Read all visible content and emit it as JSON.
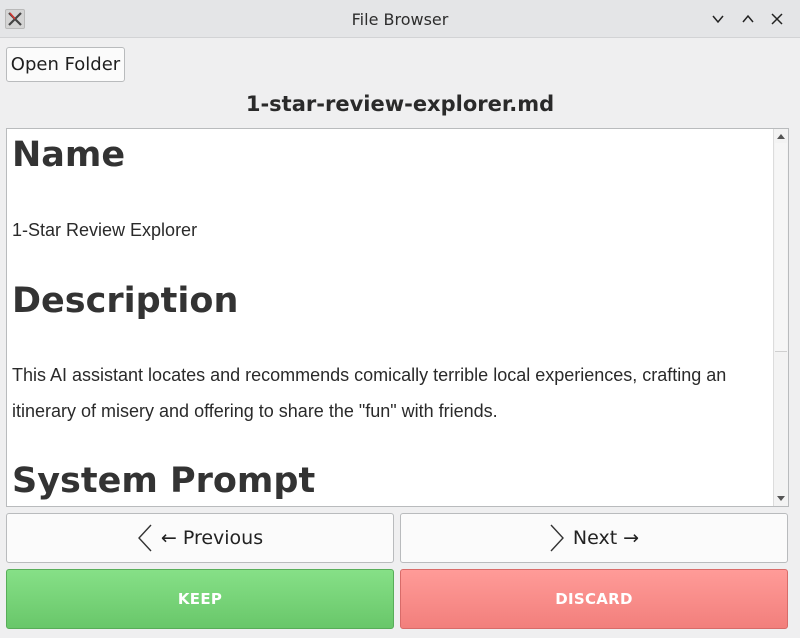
{
  "window": {
    "title": "File Browser",
    "app_icon": "x-app-icon",
    "controls": [
      "minimize-icon",
      "maximize-icon",
      "close-icon"
    ]
  },
  "toolbar": {
    "open_folder_label": "Open Folder"
  },
  "file": {
    "name": "1-star-review-explorer.md"
  },
  "document": {
    "heading_name": "Name",
    "name_text": "1-Star Review Explorer",
    "heading_description": "Description",
    "description_text": "This AI assistant locates and recommends comically terrible local experiences, crafting an itinerary of misery and offering to share the \"fun\" with friends.",
    "heading_system_prompt": "System Prompt"
  },
  "navigation": {
    "previous_label": "← Previous",
    "next_label": "Next →"
  },
  "actions": {
    "keep_label": "KEEP",
    "discard_label": "DISCARD",
    "keep_color": "#6fcd70",
    "discard_color": "#f78a87"
  }
}
